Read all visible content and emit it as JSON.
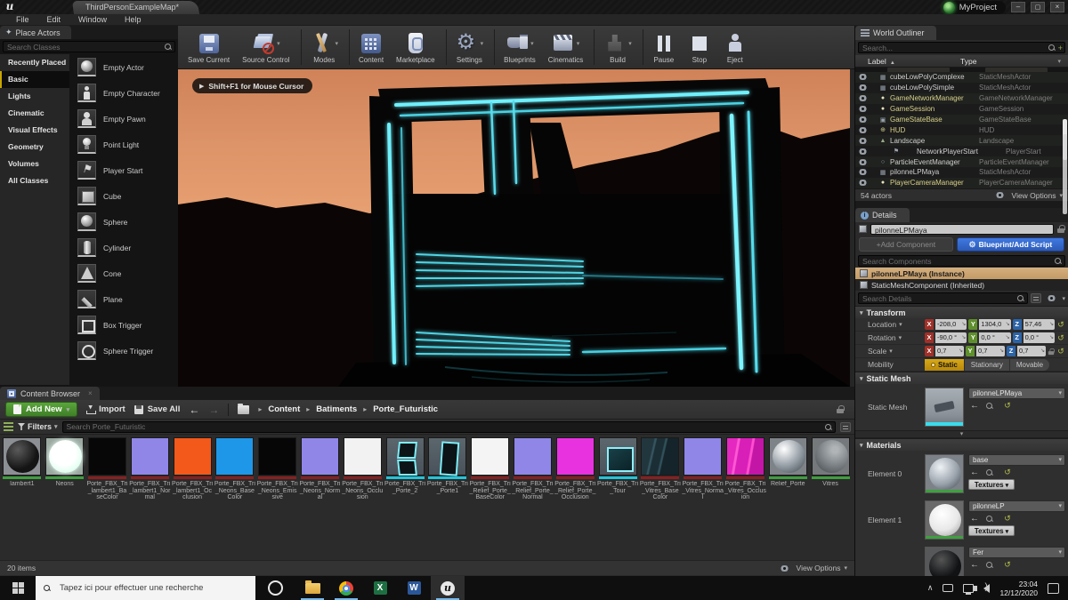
{
  "window": {
    "tab": "ThirdPersonExampleMap*",
    "project": "MyProject"
  },
  "menu": {
    "items": [
      "File",
      "Edit",
      "Window",
      "Help"
    ]
  },
  "place_actors": {
    "title": "Place Actors",
    "search_placeholder": "Search Classes",
    "categories": [
      {
        "label": "Recently Placed",
        "selected": false
      },
      {
        "label": "Basic",
        "selected": true
      },
      {
        "label": "Lights",
        "selected": false
      },
      {
        "label": "Cinematic",
        "selected": false
      },
      {
        "label": "Visual Effects",
        "selected": false
      },
      {
        "label": "Geometry",
        "selected": false
      },
      {
        "label": "Volumes",
        "selected": false
      },
      {
        "label": "All Classes",
        "selected": false
      }
    ],
    "actors": [
      {
        "label": "Empty Actor",
        "icon": "pa-sphere"
      },
      {
        "label": "Empty Character",
        "icon": "pa-character"
      },
      {
        "label": "Empty Pawn",
        "icon": "pa-pawn"
      },
      {
        "label": "Point Light",
        "icon": "pa-bulb"
      },
      {
        "label": "Player Start",
        "icon": "pa-start"
      },
      {
        "label": "Cube",
        "icon": "pa-cube"
      },
      {
        "label": "Sphere",
        "icon": "pa-sphere2"
      },
      {
        "label": "Cylinder",
        "icon": "pa-cyl"
      },
      {
        "label": "Cone",
        "icon": "pa-cone"
      },
      {
        "label": "Plane",
        "icon": "pa-plane"
      },
      {
        "label": "Box Trigger",
        "icon": "pa-boxtrig"
      },
      {
        "label": "Sphere Trigger",
        "icon": "pa-spheretrig"
      }
    ]
  },
  "toolbar": {
    "buttons": [
      {
        "label": "Save Current",
        "icon": "ic-save",
        "dropdown": false,
        "sep": false,
        "disabled": false
      },
      {
        "label": "Source Control",
        "icon": "ic-source",
        "dropdown": true,
        "sep": true,
        "disabled": false
      },
      {
        "label": "Modes",
        "icon": "ic-modes",
        "dropdown": true,
        "sep": true,
        "disabled": false
      },
      {
        "label": "Content",
        "icon": "ic-content",
        "dropdown": false,
        "sep": false,
        "disabled": false
      },
      {
        "label": "Marketplace",
        "icon": "ic-market",
        "dropdown": false,
        "sep": true,
        "disabled": false
      },
      {
        "label": "Settings",
        "icon": "ic-settings",
        "dropdown": true,
        "sep": true,
        "disabled": false
      },
      {
        "label": "Blueprints",
        "icon": "ic-bp",
        "dropdown": true,
        "sep": false,
        "disabled": false
      },
      {
        "label": "Cinematics",
        "icon": "ic-cine",
        "dropdown": true,
        "sep": true,
        "disabled": false
      },
      {
        "label": "Build",
        "icon": "ic-build",
        "dropdown": true,
        "sep": true,
        "disabled": true
      },
      {
        "label": "Pause",
        "icon": "ic-pause",
        "dropdown": false,
        "sep": false,
        "disabled": false
      },
      {
        "label": "Stop",
        "icon": "ic-stop",
        "dropdown": false,
        "sep": false,
        "disabled": false
      },
      {
        "label": "Eject",
        "icon": "ic-eject",
        "dropdown": false,
        "sep": false,
        "disabled": false
      }
    ]
  },
  "viewport": {
    "overlay": "Shift+F1 for Mouse Cursor"
  },
  "world_outliner": {
    "title": "World Outliner",
    "search_placeholder": "Search...",
    "col_label": "Label",
    "col_type": "Type",
    "rows": [
      {
        "label": "cubeLowPolyComplexe",
        "type": "StaticMeshActor",
        "icon": "mesh",
        "hl": false
      },
      {
        "label": "cubeLowPolySimple",
        "type": "StaticMeshActor",
        "icon": "mesh",
        "hl": false
      },
      {
        "label": "GameNetworkManager",
        "type": "GameNetworkManager",
        "icon": "ball",
        "hl": true
      },
      {
        "label": "GameSession",
        "type": "GameSession",
        "icon": "ball",
        "hl": true
      },
      {
        "label": "GameStateBase",
        "type": "GameStateBase",
        "icon": "state",
        "hl": true
      },
      {
        "label": "HUD",
        "type": "HUD",
        "icon": "hud",
        "hl": true
      },
      {
        "label": "Landscape",
        "type": "Landscape",
        "icon": "land",
        "hl": false
      },
      {
        "label": "NetworkPlayerStart",
        "type": "PlayerStart",
        "icon": "start",
        "hl": false
      },
      {
        "label": "ParticleEventManager",
        "type": "ParticleEventManager",
        "icon": "ball2",
        "hl": false
      },
      {
        "label": "pilonneLPMaya",
        "type": "StaticMeshActor",
        "icon": "mesh",
        "hl": false
      },
      {
        "label": "PlayerCameraManager",
        "type": "PlayerCameraManager",
        "icon": "ball",
        "hl": true
      }
    ],
    "footer_count": "54 actors",
    "view_options": "View Options"
  },
  "details": {
    "title": "Details",
    "name_value": "pilonneLPMaya",
    "add_component": "+Add Component",
    "blueprint_button": "Blueprint/Add Script",
    "search_components_placeholder": "Search Components",
    "components": [
      {
        "label": "pilonneLPMaya (Instance)",
        "selected": true,
        "inh": false
      },
      {
        "label": "StaticMeshComponent (Inherited)",
        "selected": false,
        "inh": true
      }
    ],
    "search_details_placeholder": "Search Details",
    "transform": {
      "section": "Transform",
      "axis_x": "X",
      "axis_y": "Y",
      "axis_z": "Z",
      "rows": [
        {
          "label": "Location",
          "x": "-208,0",
          "y": "1304,0",
          "z": "57,46",
          "lock": false
        },
        {
          "label": "Rotation",
          "x": "-90,0 °",
          "y": "0,0 °",
          "z": "0,0 °",
          "lock": false
        },
        {
          "label": "Scale",
          "x": "0,7",
          "y": "0,7",
          "z": "0,7",
          "lock": true
        }
      ],
      "mobility_label": "Mobility",
      "mobility_options": [
        {
          "label": "Static",
          "selected": true
        },
        {
          "label": "Stationary",
          "selected": false
        },
        {
          "label": "Movable",
          "selected": false
        }
      ]
    },
    "static_mesh": {
      "section": "Static Mesh",
      "label": "Static Mesh",
      "value": "pilonneLPMaya"
    },
    "materials": {
      "section": "Materials",
      "textures_label": "Textures",
      "elements": [
        {
          "label": "Element 0",
          "value": "base",
          "thumb": "mat-base",
          "textures": true
        },
        {
          "label": "Element 1",
          "value": "pilonneLP",
          "thumb": "mat-white",
          "textures": true
        },
        {
          "label": "",
          "value": "Fer",
          "thumb": "mat-dark",
          "textures": false
        }
      ]
    }
  },
  "content_browser": {
    "tab": "Content Browser",
    "add_new": "Add New",
    "import": "Import",
    "save_all": "Save All",
    "breadcrumbs": [
      {
        "label": "Content"
      },
      {
        "label": "Batiments"
      },
      {
        "label": "Porte_Futuristic"
      }
    ],
    "filters": "Filters",
    "search_placeholder": "Search Porte_Futuristic",
    "assets": [
      {
        "name": "lambert1",
        "kind": "k-sphere-dark",
        "bar": "#3f9f3f"
      },
      {
        "name": "Neons",
        "kind": "k-sphere-glow",
        "bar": "#3f9f3f"
      },
      {
        "name": "Porte_FBX_Tri_lambert1_BaseColor",
        "kind": "k-flat",
        "color": "#070707",
        "bar": "#8a2020"
      },
      {
        "name": "Porte_FBX_Tri_lambert1_Normal",
        "kind": "k-flat",
        "color": "#8f86e8",
        "bar": "#8a2020"
      },
      {
        "name": "Porte_FBX_Tri_lambert1_Occlusion",
        "kind": "k-flat",
        "color": "#f2591b",
        "bar": "#8a2020"
      },
      {
        "name": "Porte_FBX_Tri_Neons_Base Color",
        "kind": "k-flat",
        "color": "#1f97e8",
        "bar": "#8a2020"
      },
      {
        "name": "Porte_FBX_Tri_Neons_Emissive",
        "kind": "k-flat",
        "color": "#060606",
        "bar": "#8a2020"
      },
      {
        "name": "Porte_FBX_Tri_Neons_Normal",
        "kind": "k-flat",
        "color": "#8f86e8",
        "bar": "#8a2020"
      },
      {
        "name": "Porte_FBX_Tri_Neons_Occlusion",
        "kind": "k-flat",
        "color": "#f2f2f2",
        "bar": "#8a2020"
      },
      {
        "name": "Porte_FBX_Tri_Porte_2",
        "kind": "k-mesh-doors",
        "bar": "#22c4d8"
      },
      {
        "name": "Porte_FBX_Tri_Porte1",
        "kind": "k-mesh-door",
        "bar": "#22c4d8"
      },
      {
        "name": "Porte_FBX_Tri_Relief_Porte_BaseColor",
        "kind": "k-flat",
        "color": "#f4f4f4",
        "bar": "#8a2020"
      },
      {
        "name": "Porte_FBX_Tri_Relief_Porte_Normal",
        "kind": "k-flat",
        "color": "#8f86e8",
        "bar": "#8a2020"
      },
      {
        "name": "Porte_FBX_Tri_Relief_Porte_Occlusion",
        "kind": "k-flat",
        "color": "#e832e0",
        "bar": "#8a2020"
      },
      {
        "name": "Porte_FBX_Tri_Tour",
        "kind": "k-mesh-cube",
        "bar": "#22c4d8"
      },
      {
        "name": "Porte_FBX_Tri_Vitres_Base Color",
        "kind": "k-tex-teal",
        "bar": "#8a2020"
      },
      {
        "name": "Porte_FBX_Tri_Vitres_Normal",
        "kind": "k-flat",
        "color": "#8f86e8",
        "bar": "#8a2020"
      },
      {
        "name": "Porte_FBX_Tri_Vitres_Occlusion",
        "kind": "k-tex-pink",
        "bar": "#8a2020"
      },
      {
        "name": "Relief_Porte",
        "kind": "k-sphere-silver",
        "bar": "#3f9f3f"
      },
      {
        "name": "Vitres",
        "kind": "k-sphere-rock",
        "bar": "#3f9f3f"
      }
    ],
    "footer_count": "20 items",
    "view_options": "View Options"
  },
  "taskbar": {
    "search_placeholder": "Tapez ici pour effectuer une recherche",
    "time": "23:04",
    "date": "12/12/2020"
  }
}
